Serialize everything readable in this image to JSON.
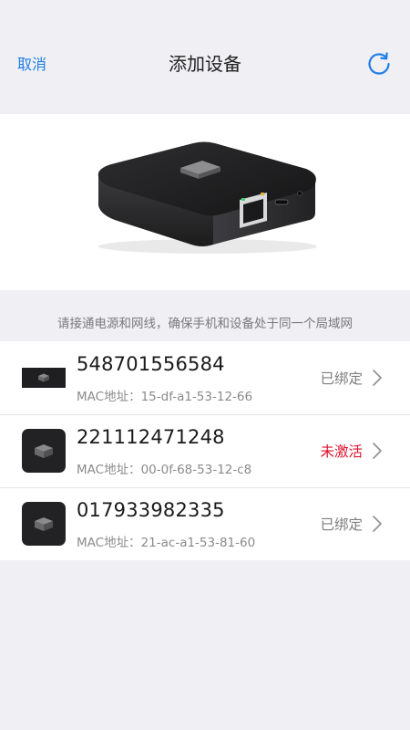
{
  "nav": {
    "cancel_label": "取消",
    "title": "添加设备",
    "refresh_icon": "refresh-icon",
    "accent_color": "#1f7ee6"
  },
  "hint": "请接通电源和网线，确保手机和设备处于同一个局域网",
  "devices": [
    {
      "serial": "548701556584",
      "mac": "MAC地址：15-df-a1-53-12-66",
      "status": "已绑定",
      "status_color": "#7d7d7d"
    },
    {
      "serial": "221112471248",
      "mac": "MAC地址：00-0f-68-53-12-c8",
      "status": "未激活",
      "status_color": "#e0112b"
    },
    {
      "serial": "017933982335",
      "mac": "MAC地址：21-ac-a1-53-81-60",
      "status": "已绑定",
      "status_color": "#7d7d7d"
    }
  ]
}
